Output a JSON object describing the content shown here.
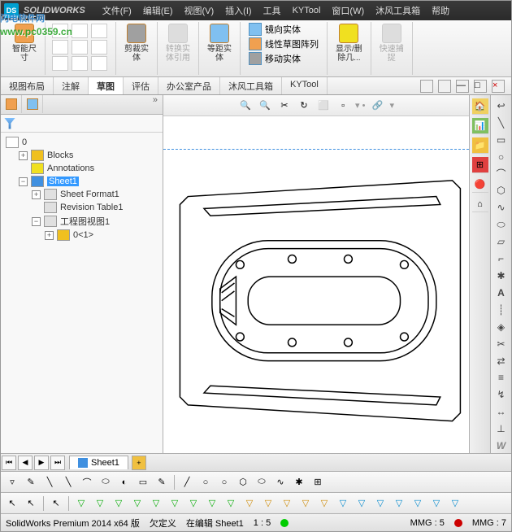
{
  "app_title": "SOLIDWORKS",
  "menus": [
    "文件(F)",
    "编辑(E)",
    "视图(V)",
    "插入(I)",
    "工具",
    "KYTool",
    "窗口(W)",
    "沐风工具箱",
    "帮助"
  ],
  "ribbon": {
    "smart_dim": "智能尺\n寸",
    "trim": "剪裁实\n体",
    "convert": "转换实\n体引用",
    "offset": "等距实\n体",
    "mirror": "镜向实体",
    "linear": "线性草图阵列",
    "move": "移动实体",
    "display": "显示/删\n除几...",
    "quick": "快速捕\n捉"
  },
  "tabs": [
    "视图布局",
    "注解",
    "草图",
    "评估",
    "办公室产品",
    "沐风工具箱",
    "KYTool"
  ],
  "active_tab": 2,
  "tree": {
    "root": "0",
    "blocks": "Blocks",
    "annotations": "Annotations",
    "sheet": "Sheet1",
    "sheet_format": "Sheet Format1",
    "revision_table": "Revision Table1",
    "drawing_view": "工程图视图1",
    "part": "0<1>"
  },
  "bottom_tab": "Sheet1",
  "status": {
    "product": "SolidWorks Premium 2014 x64 版",
    "under_defined": "欠定义",
    "editing": "在编辑 Sheet1",
    "scale": "1 : 5",
    "mmg1": "MMG : 5",
    "mmg2": "MMG : 7"
  },
  "watermark": {
    "title": "闪电软件网",
    "url": "www.pc0359.cn"
  }
}
